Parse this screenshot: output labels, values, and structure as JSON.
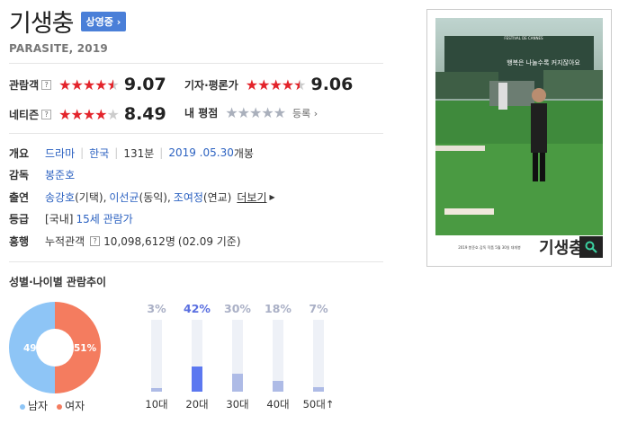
{
  "movie": {
    "title": "기생충",
    "status_badge": "상영중",
    "english_title": "PARASITE, 2019"
  },
  "ratings": {
    "audience": {
      "label": "관람객",
      "stars_fraction": 0.9,
      "score": "9.07"
    },
    "critic": {
      "label": "기자·평론가",
      "stars_fraction": 0.9,
      "score": "9.06"
    },
    "netizen": {
      "label": "네티즌",
      "stars_fraction": 0.85,
      "score": "8.49"
    },
    "my": {
      "label": "내 평점",
      "register_label": "등록"
    }
  },
  "info": {
    "overview_label": "개요",
    "genre": "드라마",
    "country": "한국",
    "runtime": "131분",
    "release_date": "2019 .05.30",
    "release_suffix": "개봉",
    "director_label": "감독",
    "director": "봉준호",
    "cast_label": "출연",
    "cast1": "송강호",
    "cast1_role": "(기택),",
    "cast2": "이선균",
    "cast2_role": "(동익),",
    "cast3": "조여정",
    "cast3_role": "(연교)",
    "more_label": "더보기",
    "grade_label": "등급",
    "grade_prefix": "[국내]",
    "grade": "15세 관람가",
    "boxoffice_label": "흥행",
    "cumulative_label": "누적관객",
    "cumulative": "10,098,612명",
    "cumulative_note": "(02.09 기준)"
  },
  "demographics": {
    "section_title": "성별·나이별 관람추이",
    "male_label": "남자",
    "female_label": "여자",
    "male_pct": "49%",
    "female_pct": "51%",
    "male_color": "#8ec5f6",
    "female_color": "#f47c5f"
  },
  "chart_data": {
    "type": "bar",
    "categories": [
      "10대",
      "20대",
      "30대",
      "40대",
      "50대↑"
    ],
    "values": [
      3,
      42,
      30,
      18,
      7
    ],
    "labels": [
      "3%",
      "42%",
      "30%",
      "18%",
      "7%"
    ],
    "highlight_index": 1,
    "ylim": [
      0,
      100
    ]
  },
  "poster": {
    "tagline": "행복은 나눌수록 커지잖아요",
    "title_text": "기생충",
    "festival": "FESTIVAL DE CANNES",
    "credits": "2019 봉준호 감독 작품 5월 30일 대개봉",
    "zoom_icon": "magnifier-icon"
  }
}
